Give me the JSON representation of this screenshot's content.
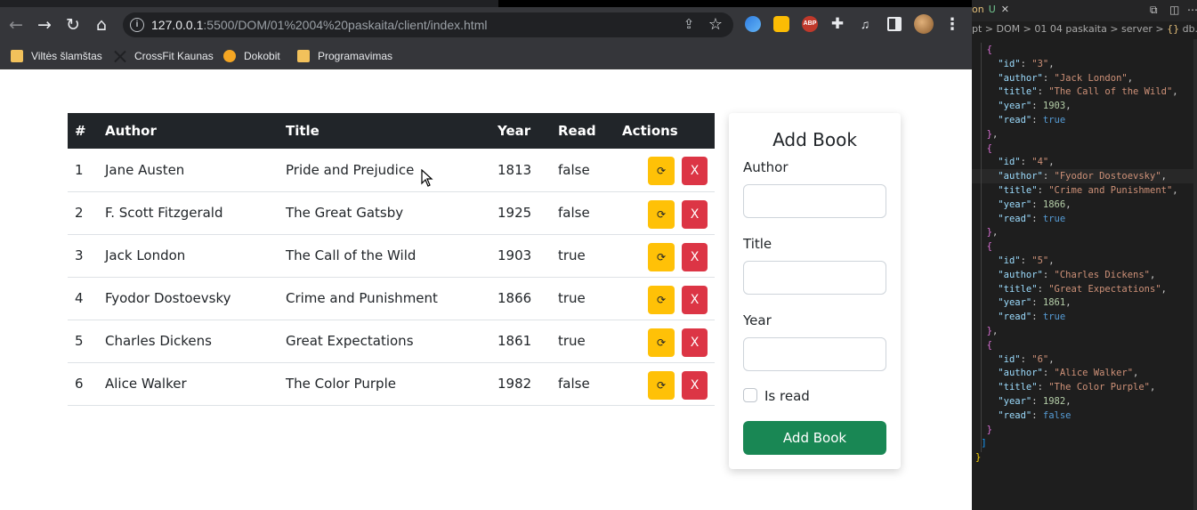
{
  "browser": {
    "url_host": "127.0.0.1",
    "url_rest": ":5500/DOM/01%2004%20paskaita/client/index.html",
    "nav_icons": [
      "back-arrow-icon",
      "forward-arrow-icon",
      "reload-icon",
      "home-icon"
    ],
    "bookmarks": [
      {
        "label": "Viltės šlamštas",
        "icon": "folder-icon"
      },
      {
        "label": "CrossFit Kaunas",
        "icon": "crossfit-icon"
      },
      {
        "label": "Dokobit",
        "icon": "dokobit-icon"
      },
      {
        "label": "Programavimas",
        "icon": "folder-icon"
      }
    ],
    "extensions": [
      "edge-ext-icon",
      "keep-ext-icon",
      "adblock-icon",
      "puzzle-icon",
      "media-icon",
      "side-panel-icon"
    ],
    "abp_text": "ABP"
  },
  "table": {
    "headers": {
      "num": "#",
      "author": "Author",
      "title": "Title",
      "year": "Year",
      "read": "Read",
      "actions": "Actions"
    },
    "rows": [
      {
        "num": "1",
        "author": "Jane Austen",
        "title": "Pride and Prejudice",
        "year": "1813",
        "read": "false"
      },
      {
        "num": "2",
        "author": "F. Scott Fitzgerald",
        "title": "The Great Gatsby",
        "year": "1925",
        "read": "false"
      },
      {
        "num": "3",
        "author": "Jack London",
        "title": "The Call of the Wild",
        "year": "1903",
        "read": "true"
      },
      {
        "num": "4",
        "author": "Fyodor Dostoevsky",
        "title": "Crime and Punishment",
        "year": "1866",
        "read": "true"
      },
      {
        "num": "5",
        "author": "Charles Dickens",
        "title": "Great Expectations",
        "year": "1861",
        "read": "true"
      },
      {
        "num": "6",
        "author": "Alice Walker",
        "title": "The Color Purple",
        "year": "1982",
        "read": "false"
      }
    ],
    "edit_glyph": "⟳",
    "delete_glyph": "X"
  },
  "form": {
    "title": "Add Book",
    "author_label": "Author",
    "title_label": "Title",
    "year_label": "Year",
    "author_value": "",
    "title_value": "",
    "year_value": "",
    "is_read_label": "Is read",
    "is_read_checked": false,
    "submit_label": "Add Book"
  },
  "editor": {
    "tab_name": "on",
    "tab_status": "U",
    "breadcrumbs": [
      "pt",
      "DOM",
      "01 04 paskaita",
      "server",
      "db.json"
    ],
    "code": [
      {
        "id": "3",
        "author": "Jack London",
        "title": "The Call of the Wild",
        "year": 1903,
        "read": "true"
      },
      {
        "id": "4",
        "author": "Fyodor Dostoevsky",
        "title": "Crime and Punishment",
        "year": 1866,
        "read": "true"
      },
      {
        "id": "5",
        "author": "Charles Dickens",
        "title": "Great Expectations",
        "year": 1861,
        "read": "true"
      },
      {
        "id": "6",
        "author": "Alice Walker",
        "title": "The Color Purple",
        "year": 1982,
        "read": "false"
      }
    ],
    "closing": [
      "]",
      "}"
    ]
  },
  "colors": {
    "table_header_bg": "#212529",
    "edit_button": "#ffc107",
    "delete_button": "#dc3545",
    "add_button": "#198754",
    "editor_bg": "#1e1e1e"
  }
}
